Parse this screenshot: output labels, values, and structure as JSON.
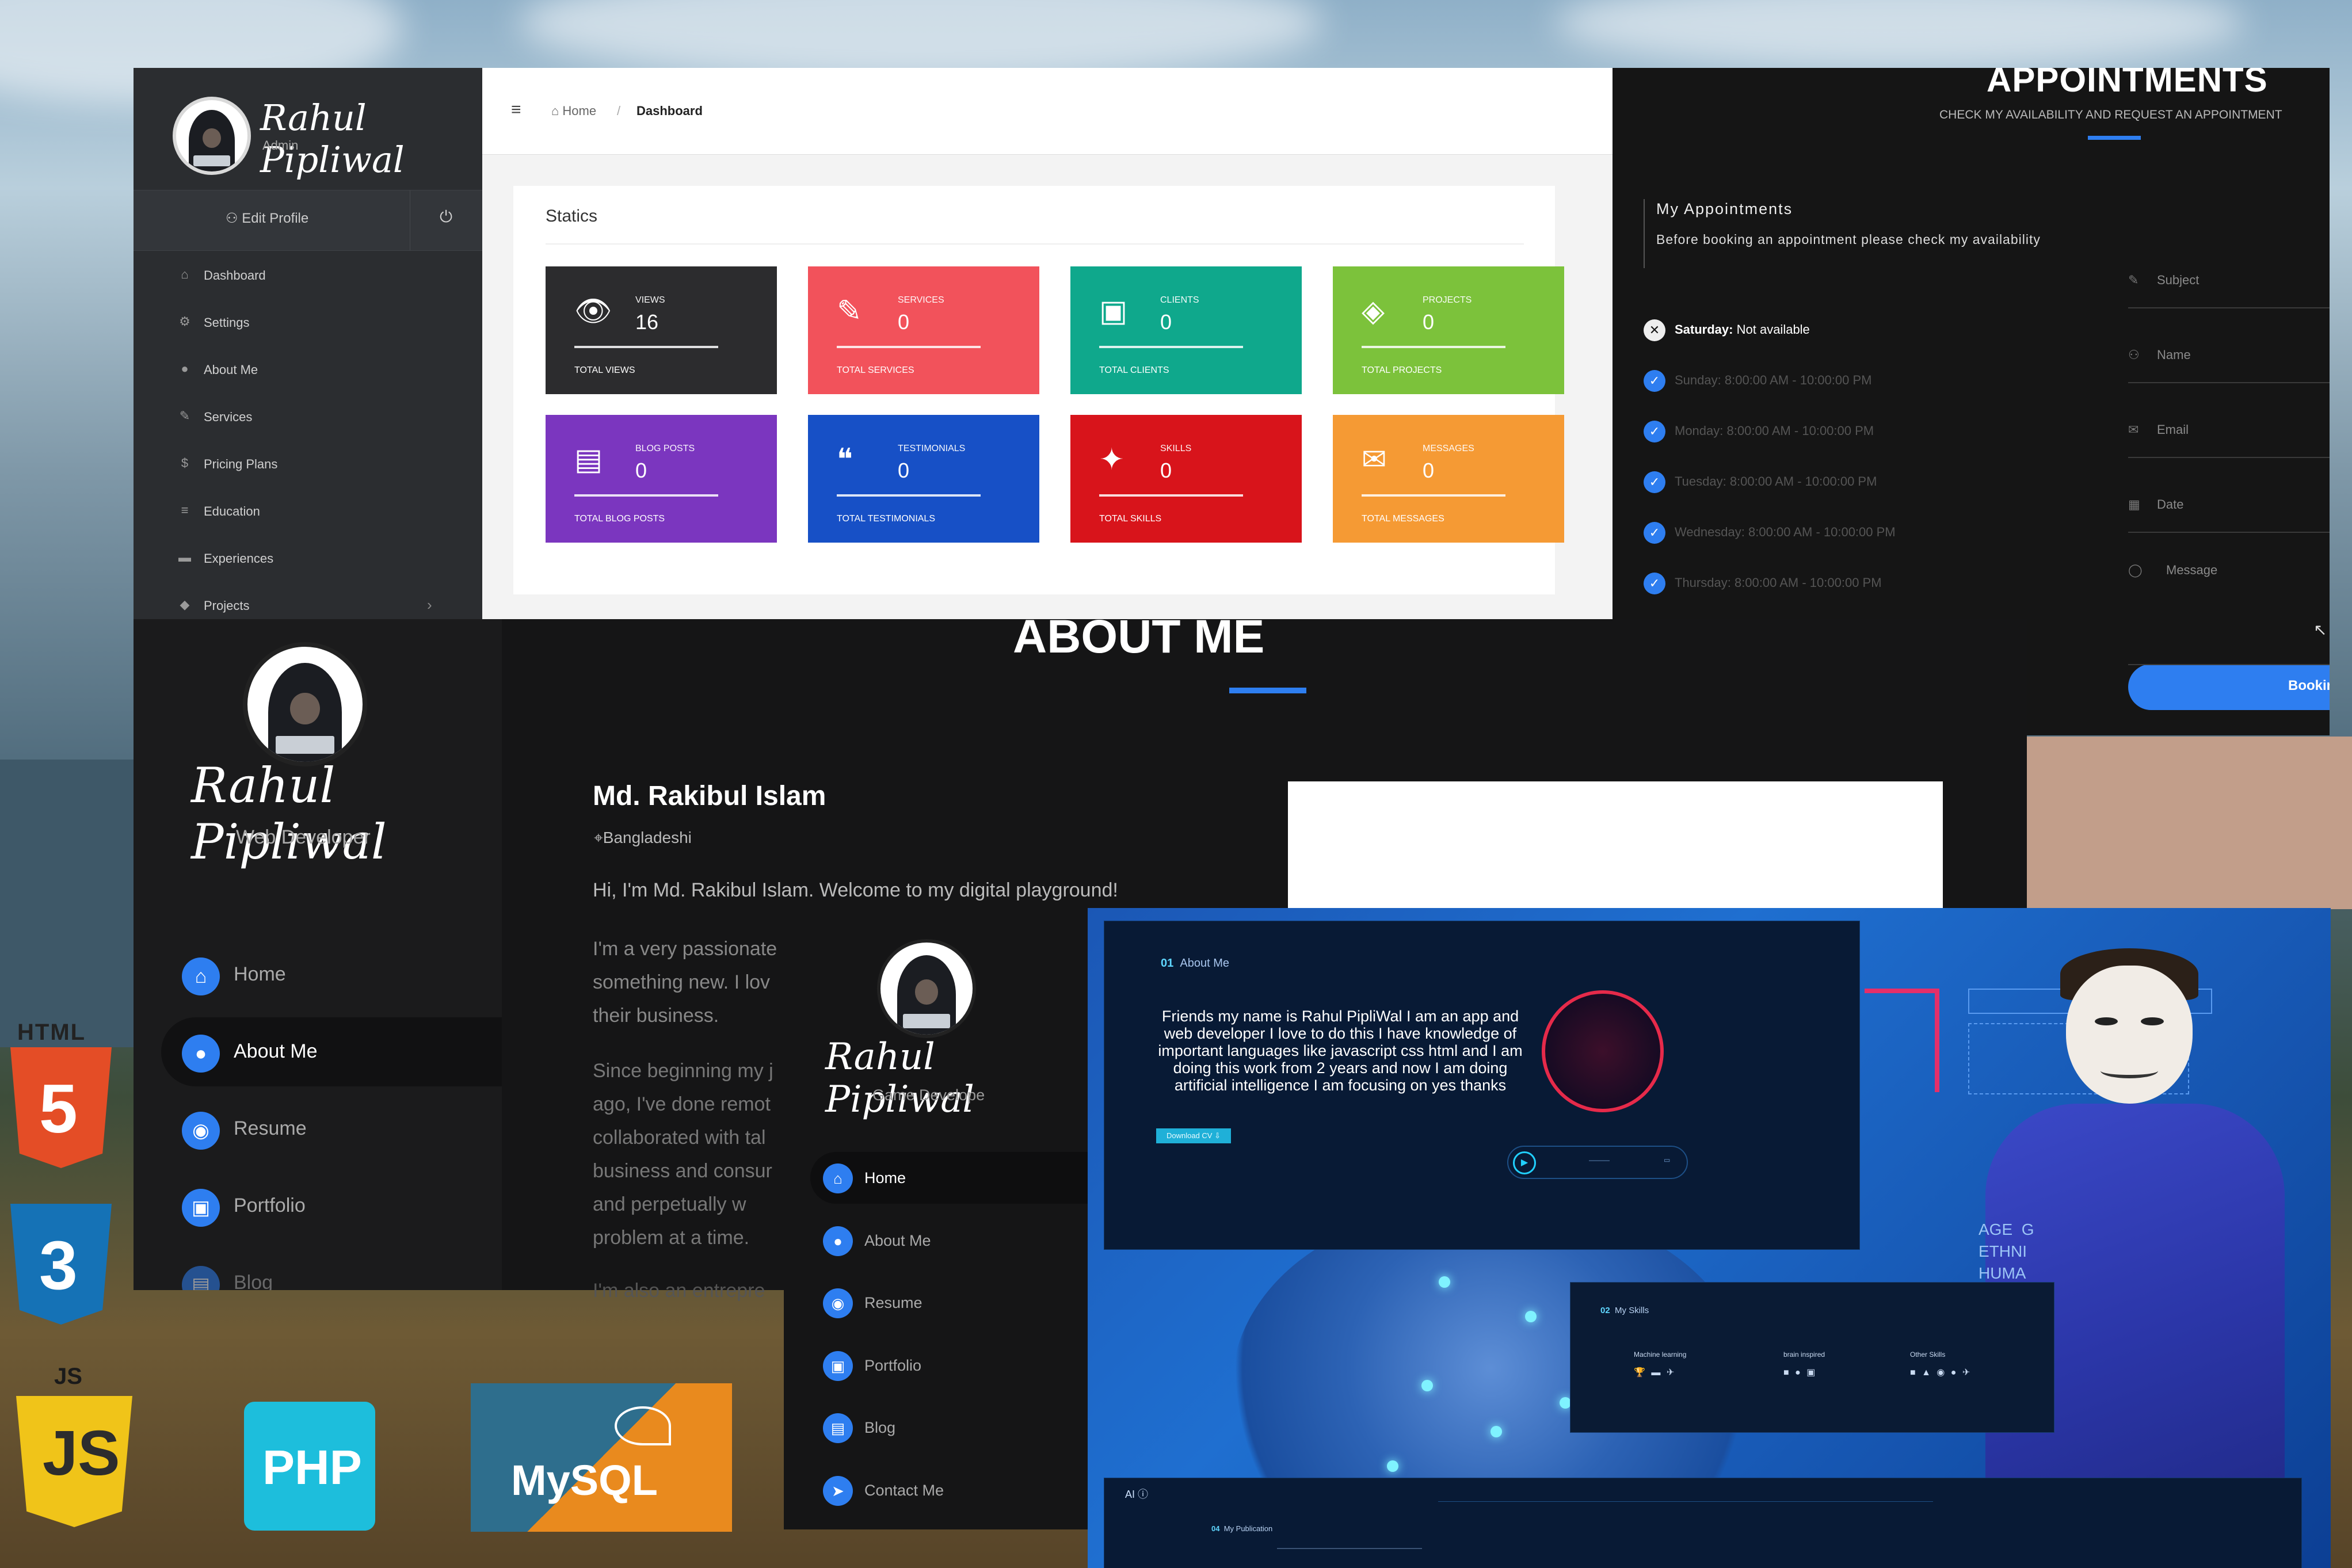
{
  "admin": {
    "profile_name": "Rahul Pipliwal",
    "profile_role": "Admin",
    "edit_profile": "Edit Profile",
    "menu": [
      {
        "icon": "home-icon",
        "glyph": "⌂",
        "label": "Dashboard"
      },
      {
        "icon": "gears-icon",
        "glyph": "⚙",
        "label": "Settings"
      },
      {
        "icon": "user-icon",
        "glyph": "●",
        "label": "About Me"
      },
      {
        "icon": "wand-icon",
        "glyph": "✎",
        "label": "Services"
      },
      {
        "icon": "dollar-icon",
        "glyph": "$",
        "label": "Pricing Plans"
      },
      {
        "icon": "graduation-cap-icon",
        "glyph": "≡",
        "label": "Education"
      },
      {
        "icon": "briefcase-icon",
        "glyph": "▬",
        "label": "Experiences"
      },
      {
        "icon": "tags-icon",
        "glyph": "◆",
        "label": "Projects"
      }
    ],
    "breadcrumb": {
      "home": "Home",
      "separator": "/",
      "current": "Dashboard"
    },
    "statics_title": "Statics",
    "cards": [
      {
        "icon": "eye-icon",
        "glyph": "👁",
        "label": "VIEWS",
        "value": "16",
        "total": "TOTAL VIEWS",
        "color": "#2c2c2e"
      },
      {
        "icon": "magic-icon",
        "glyph": "✎",
        "label": "SERVICES",
        "value": "0",
        "total": "TOTAL SERVICES",
        "color": "#f2525b"
      },
      {
        "icon": "briefcase-icon",
        "glyph": "▣",
        "label": "CLIENTS",
        "value": "0",
        "total": "TOTAL CLIENTS",
        "color": "#0fa88c"
      },
      {
        "icon": "tags-icon",
        "glyph": "◈",
        "label": "PROJECTS",
        "value": "0",
        "total": "TOTAL PROJECTS",
        "color": "#7cc23b"
      },
      {
        "icon": "newspaper-icon",
        "glyph": "▤",
        "label": "BLOG POSTS",
        "value": "0",
        "total": "TOTAL BLOG POSTS",
        "color": "#7b36bf"
      },
      {
        "icon": "comments-icon",
        "glyph": "❝",
        "label": "TESTIMONIALS",
        "value": "0",
        "total": "TOTAL TESTIMONIALS",
        "color": "#1750c6"
      },
      {
        "icon": "lightbulb-icon",
        "glyph": "✦",
        "label": "SKILLS",
        "value": "0",
        "total": "TOTAL SKILLS",
        "color": "#d8141b"
      },
      {
        "icon": "envelope-icon",
        "glyph": "✉",
        "label": "MESSAGES",
        "value": "0",
        "total": "TOTAL MESSAGES",
        "color": "#f59a34"
      }
    ]
  },
  "appointments": {
    "title": "APPOINTMENTS",
    "subtitle": "CHECK MY AVAILABILITY AND REQUEST AN APPOINTMENT",
    "my_title": "My Appointments",
    "my_text": "Before booking an appointment please check my availability",
    "days": [
      {
        "day": "Saturday:",
        "hours": "Not available",
        "available": false
      },
      {
        "day": "Sunday:",
        "hours": "8:00:00 AM - 10:00:00 PM",
        "available": true
      },
      {
        "day": "Monday:",
        "hours": "8:00:00 AM - 10:00:00 PM",
        "available": true
      },
      {
        "day": "Tuesday:",
        "hours": "8:00:00 AM - 10:00:00 PM",
        "available": true
      },
      {
        "day": "Wednesday:",
        "hours": "8:00:00 AM - 10:00:00 PM",
        "available": true
      },
      {
        "day": "Thursday:",
        "hours": "8:00:00 AM - 10:00:00 PM",
        "available": true
      }
    ],
    "fields": [
      {
        "icon": "pencil-icon",
        "glyph": "✎",
        "placeholder": "Subject"
      },
      {
        "icon": "user-icon",
        "glyph": "⚇",
        "placeholder": "Name"
      },
      {
        "icon": "envelope-icon",
        "glyph": "✉",
        "placeholder": "Email"
      },
      {
        "icon": "calendar-icon",
        "glyph": "▦",
        "placeholder": "Date"
      },
      {
        "icon": "comment-icon",
        "glyph": "◯",
        "placeholder": "Message"
      }
    ],
    "book_button": "Bookin"
  },
  "portfolio": {
    "name": "Rahul Pipliwal",
    "role": "Web Developer",
    "menu": [
      {
        "icon": "home-icon",
        "glyph": "⌂",
        "label": "Home",
        "active": false
      },
      {
        "icon": "user-icon",
        "glyph": "●",
        "label": "About Me",
        "active": true
      },
      {
        "icon": "resume-icon",
        "glyph": "◉",
        "label": "Resume",
        "active": false
      },
      {
        "icon": "portfolio-icon",
        "glyph": "▣",
        "label": "Portfolio",
        "active": false
      },
      {
        "icon": "blog-icon",
        "glyph": "▤",
        "label": "Blog",
        "active": false
      }
    ],
    "about_title": "ABOUT ME",
    "who": "Md. Rakibul Islam",
    "location": "Bangladeshi",
    "greeting": "Hi, I'm Md. Rakibul Islam. Welcome to my digital playground!",
    "para1": "I'm a very passionate something new. I lov their business.",
    "para2": "Since beginning my j ago, I've done remot collaborated with tal business and consur and perpetually w problem at a time.",
    "para3": "I'm also an entrepre"
  },
  "game": {
    "name": "Rahul Pipliwal",
    "role": "Game Develope",
    "menu": [
      {
        "icon": "home-icon",
        "glyph": "⌂",
        "label": "Home",
        "active": true
      },
      {
        "icon": "user-icon",
        "glyph": "●",
        "label": "About Me",
        "active": false
      },
      {
        "icon": "resume-icon",
        "glyph": "◉",
        "label": "Resume",
        "active": false
      },
      {
        "icon": "portfolio-icon",
        "glyph": "▣",
        "label": "Portfolio",
        "active": false
      },
      {
        "icon": "blog-icon",
        "glyph": "▤",
        "label": "Blog",
        "active": false
      },
      {
        "icon": "paper-plane-icon",
        "glyph": "➤",
        "label": "Contact Me",
        "active": false
      }
    ]
  },
  "ai": {
    "about_num": "01",
    "about_label": "About Me",
    "bio": "Friends my name is Rahul PipliWal I am an app and web developer I love to do this I have knowledge of important languages like javascript css html and I am doing this work from 2 years and now I am doing artificial intelligence I am focusing on yes thanks",
    "download": "Download CV",
    "skills_num": "02",
    "skills_label": "My Skills",
    "skill_cols": [
      "Machine learning",
      "brain inspired",
      "Other Skills"
    ],
    "bottom_label": "AI",
    "pub_num": "04",
    "pub_label": "My Publication",
    "side_text": "AGE  G\nETHNI\nHUMA"
  },
  "logos": {
    "html": "HTML",
    "html_num": "5",
    "css_num": "3",
    "js": "JS",
    "js_big": "JS",
    "php": "PHP",
    "mysql": "MySQL"
  }
}
